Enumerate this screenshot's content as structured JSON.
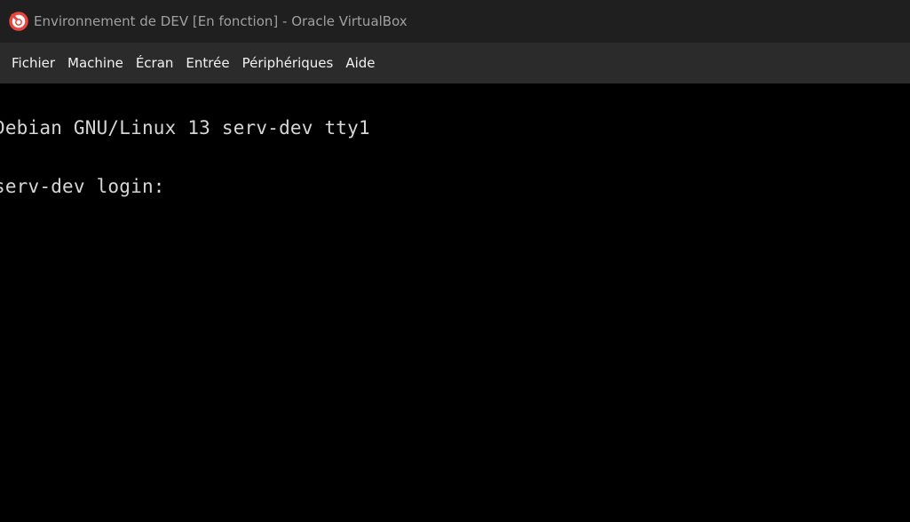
{
  "window": {
    "title": "Environnement de DEV [En fonction] - Oracle VirtualBox",
    "icon": "virtualbox-app-icon"
  },
  "menubar": {
    "items": [
      {
        "label": "Fichier"
      },
      {
        "label": "Machine"
      },
      {
        "label": "Écran"
      },
      {
        "label": "Entrée"
      },
      {
        "label": "Périphériques"
      },
      {
        "label": "Aide"
      }
    ]
  },
  "console": {
    "lines": [
      "Debian GNU/Linux 13 serv-dev tty1",
      "serv-dev login: "
    ]
  },
  "colors": {
    "titlebar_bg": "#1f1f1f",
    "menubar_bg": "#2b2b2b",
    "screen_bg": "#000000",
    "console_text": "#d6d6d6",
    "icon_accent": "#e8453c"
  }
}
